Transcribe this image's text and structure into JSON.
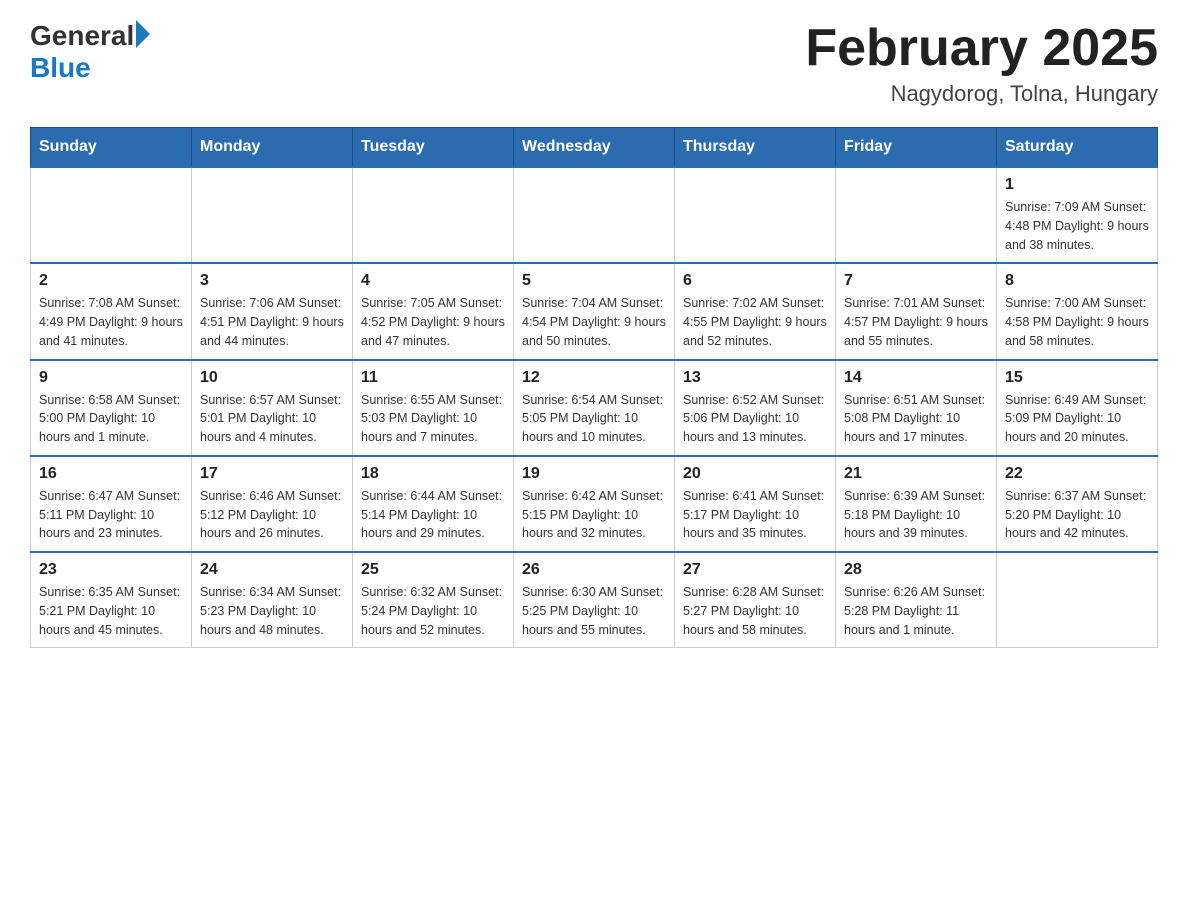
{
  "logo": {
    "general": "General",
    "blue": "Blue"
  },
  "title": "February 2025",
  "subtitle": "Nagydorog, Tolna, Hungary",
  "days_of_week": [
    "Sunday",
    "Monday",
    "Tuesday",
    "Wednesday",
    "Thursday",
    "Friday",
    "Saturday"
  ],
  "weeks": [
    [
      {
        "day": "",
        "info": ""
      },
      {
        "day": "",
        "info": ""
      },
      {
        "day": "",
        "info": ""
      },
      {
        "day": "",
        "info": ""
      },
      {
        "day": "",
        "info": ""
      },
      {
        "day": "",
        "info": ""
      },
      {
        "day": "1",
        "info": "Sunrise: 7:09 AM\nSunset: 4:48 PM\nDaylight: 9 hours\nand 38 minutes."
      }
    ],
    [
      {
        "day": "2",
        "info": "Sunrise: 7:08 AM\nSunset: 4:49 PM\nDaylight: 9 hours\nand 41 minutes."
      },
      {
        "day": "3",
        "info": "Sunrise: 7:06 AM\nSunset: 4:51 PM\nDaylight: 9 hours\nand 44 minutes."
      },
      {
        "day": "4",
        "info": "Sunrise: 7:05 AM\nSunset: 4:52 PM\nDaylight: 9 hours\nand 47 minutes."
      },
      {
        "day": "5",
        "info": "Sunrise: 7:04 AM\nSunset: 4:54 PM\nDaylight: 9 hours\nand 50 minutes."
      },
      {
        "day": "6",
        "info": "Sunrise: 7:02 AM\nSunset: 4:55 PM\nDaylight: 9 hours\nand 52 minutes."
      },
      {
        "day": "7",
        "info": "Sunrise: 7:01 AM\nSunset: 4:57 PM\nDaylight: 9 hours\nand 55 minutes."
      },
      {
        "day": "8",
        "info": "Sunrise: 7:00 AM\nSunset: 4:58 PM\nDaylight: 9 hours\nand 58 minutes."
      }
    ],
    [
      {
        "day": "9",
        "info": "Sunrise: 6:58 AM\nSunset: 5:00 PM\nDaylight: 10 hours\nand 1 minute."
      },
      {
        "day": "10",
        "info": "Sunrise: 6:57 AM\nSunset: 5:01 PM\nDaylight: 10 hours\nand 4 minutes."
      },
      {
        "day": "11",
        "info": "Sunrise: 6:55 AM\nSunset: 5:03 PM\nDaylight: 10 hours\nand 7 minutes."
      },
      {
        "day": "12",
        "info": "Sunrise: 6:54 AM\nSunset: 5:05 PM\nDaylight: 10 hours\nand 10 minutes."
      },
      {
        "day": "13",
        "info": "Sunrise: 6:52 AM\nSunset: 5:06 PM\nDaylight: 10 hours\nand 13 minutes."
      },
      {
        "day": "14",
        "info": "Sunrise: 6:51 AM\nSunset: 5:08 PM\nDaylight: 10 hours\nand 17 minutes."
      },
      {
        "day": "15",
        "info": "Sunrise: 6:49 AM\nSunset: 5:09 PM\nDaylight: 10 hours\nand 20 minutes."
      }
    ],
    [
      {
        "day": "16",
        "info": "Sunrise: 6:47 AM\nSunset: 5:11 PM\nDaylight: 10 hours\nand 23 minutes."
      },
      {
        "day": "17",
        "info": "Sunrise: 6:46 AM\nSunset: 5:12 PM\nDaylight: 10 hours\nand 26 minutes."
      },
      {
        "day": "18",
        "info": "Sunrise: 6:44 AM\nSunset: 5:14 PM\nDaylight: 10 hours\nand 29 minutes."
      },
      {
        "day": "19",
        "info": "Sunrise: 6:42 AM\nSunset: 5:15 PM\nDaylight: 10 hours\nand 32 minutes."
      },
      {
        "day": "20",
        "info": "Sunrise: 6:41 AM\nSunset: 5:17 PM\nDaylight: 10 hours\nand 35 minutes."
      },
      {
        "day": "21",
        "info": "Sunrise: 6:39 AM\nSunset: 5:18 PM\nDaylight: 10 hours\nand 39 minutes."
      },
      {
        "day": "22",
        "info": "Sunrise: 6:37 AM\nSunset: 5:20 PM\nDaylight: 10 hours\nand 42 minutes."
      }
    ],
    [
      {
        "day": "23",
        "info": "Sunrise: 6:35 AM\nSunset: 5:21 PM\nDaylight: 10 hours\nand 45 minutes."
      },
      {
        "day": "24",
        "info": "Sunrise: 6:34 AM\nSunset: 5:23 PM\nDaylight: 10 hours\nand 48 minutes."
      },
      {
        "day": "25",
        "info": "Sunrise: 6:32 AM\nSunset: 5:24 PM\nDaylight: 10 hours\nand 52 minutes."
      },
      {
        "day": "26",
        "info": "Sunrise: 6:30 AM\nSunset: 5:25 PM\nDaylight: 10 hours\nand 55 minutes."
      },
      {
        "day": "27",
        "info": "Sunrise: 6:28 AM\nSunset: 5:27 PM\nDaylight: 10 hours\nand 58 minutes."
      },
      {
        "day": "28",
        "info": "Sunrise: 6:26 AM\nSunset: 5:28 PM\nDaylight: 11 hours\nand 1 minute."
      },
      {
        "day": "",
        "info": ""
      }
    ]
  ]
}
